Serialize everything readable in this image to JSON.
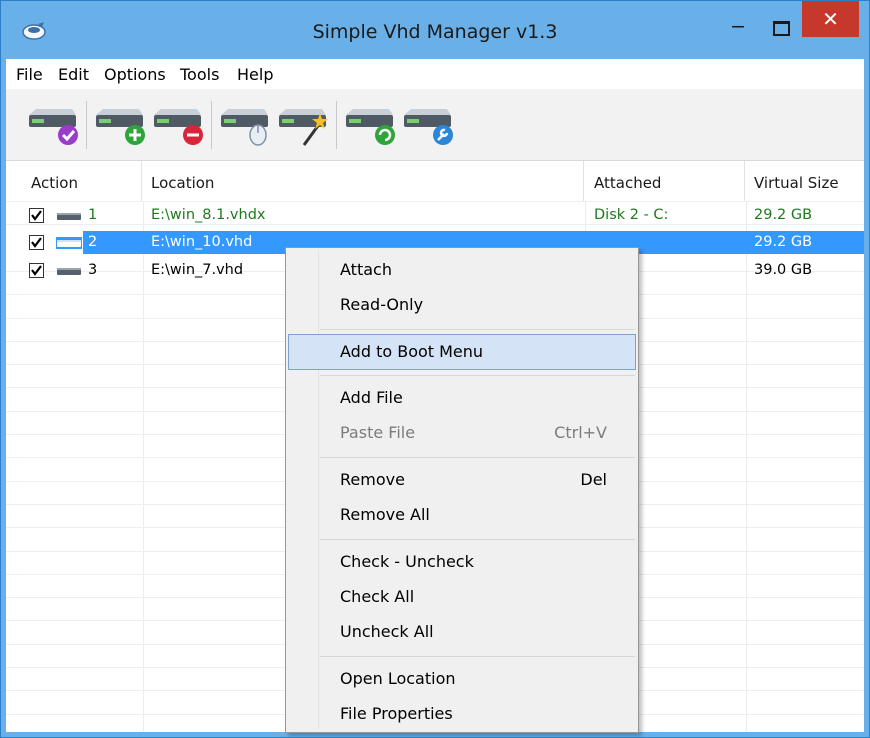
{
  "window": {
    "title": "Simple Vhd Manager v1.3",
    "controls": {
      "minimize": "‒",
      "close": "✕"
    },
    "accent_color": "#6ab0e8",
    "close_color": "#c7382c"
  },
  "menu": [
    "File",
    "Edit",
    "Options",
    "Tools",
    "Help"
  ],
  "toolbar": {
    "buttons": [
      {
        "icon": "disk-check-icon",
        "badge_color": "#9b3cc8"
      },
      {
        "icon": "disk-add-icon",
        "badge_color": "#2fa43a"
      },
      {
        "icon": "disk-remove-icon",
        "badge_color": "#d8253a"
      },
      {
        "icon": "disk-mouse-icon",
        "badge_color": "#8090a8"
      },
      {
        "icon": "disk-wand-icon",
        "badge_color": "#f5c020"
      },
      {
        "icon": "disk-refresh-icon",
        "badge_color": "#2fa43a"
      },
      {
        "icon": "disk-settings-icon",
        "badge_color": "#2b86d8"
      }
    ]
  },
  "table": {
    "columns": [
      "Action",
      "Location",
      "Attached",
      "Virtual Size"
    ],
    "rows": [
      {
        "checked": true,
        "num": "1",
        "location": "E:\\win_8.1.vhdx",
        "attached": "Disk 2  -  C:",
        "size": "29.2 GB",
        "state": "attached"
      },
      {
        "checked": true,
        "num": "2",
        "location": "E:\\win_10.vhd",
        "attached": "",
        "size": "29.2 GB",
        "state": "selected"
      },
      {
        "checked": true,
        "num": "3",
        "location": "E:\\win_7.vhd",
        "attached": "",
        "size": "39.0 GB",
        "state": "normal"
      }
    ],
    "selected_color": "#3399ff",
    "attached_color": "#1e7a1e"
  },
  "context_menu": {
    "items": [
      {
        "label": "Attach",
        "shortcut": ""
      },
      {
        "label": "Read-Only",
        "shortcut": ""
      },
      {
        "label": "Add to Boot Menu",
        "shortcut": "",
        "highlighted": true
      },
      {
        "label": "Add File",
        "shortcut": ""
      },
      {
        "label": "Paste File",
        "shortcut": "Ctrl+V",
        "disabled": true
      },
      {
        "label": "Remove",
        "shortcut": "Del"
      },
      {
        "label": "Remove All",
        "shortcut": ""
      },
      {
        "label": "Check - Uncheck",
        "shortcut": ""
      },
      {
        "label": "Check All",
        "shortcut": ""
      },
      {
        "label": "Uncheck All",
        "shortcut": ""
      },
      {
        "label": "Open Location",
        "shortcut": ""
      },
      {
        "label": "File Properties",
        "shortcut": ""
      }
    ]
  }
}
